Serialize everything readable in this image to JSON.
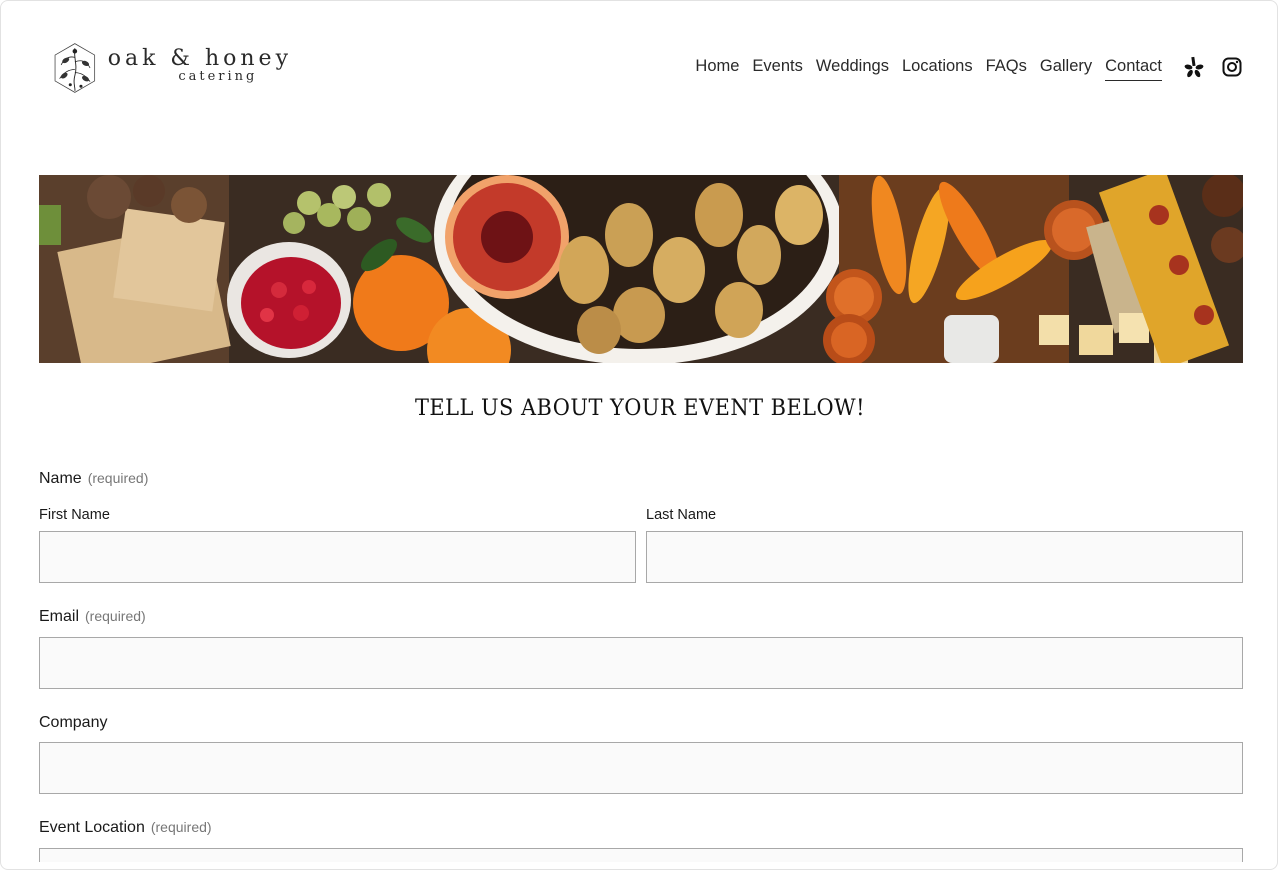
{
  "brand": {
    "name": "oak & honey",
    "sub": "catering"
  },
  "nav": {
    "items": [
      {
        "label": "Home"
      },
      {
        "label": "Events"
      },
      {
        "label": "Weddings"
      },
      {
        "label": "Locations"
      },
      {
        "label": "FAQs"
      },
      {
        "label": "Gallery"
      },
      {
        "label": "Contact",
        "active": true
      }
    ]
  },
  "social": {
    "icons": [
      "yelp-icon",
      "instagram-icon"
    ]
  },
  "banner": {
    "alt": "grazing table with fruits and vegetables"
  },
  "form": {
    "heading": "TELL US ABOUT YOUR EVENT BELOW!",
    "name": {
      "label": "Name",
      "required": "(required)",
      "first_label": "First Name",
      "first_value": "",
      "last_label": "Last Name",
      "last_value": ""
    },
    "email": {
      "label": "Email",
      "required": "(required)",
      "value": ""
    },
    "company": {
      "label": "Company",
      "value": ""
    },
    "event_location": {
      "label": "Event Location",
      "required": "(required)",
      "value": ""
    }
  },
  "colors": {
    "text": "#1a1a1a",
    "input_bg": "#fafafa",
    "input_border": "#a8a8a8",
    "required": "#777777"
  }
}
